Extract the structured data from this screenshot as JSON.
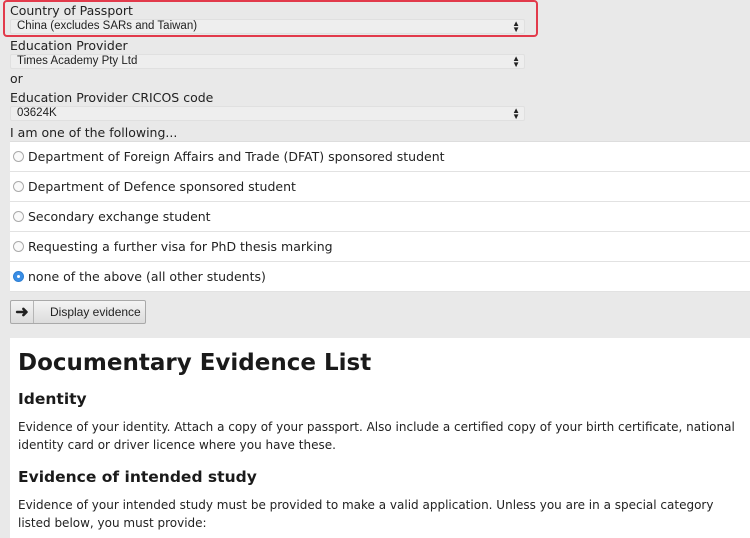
{
  "form": {
    "passport_label": "Country of Passport",
    "passport_value": "China (excludes SARs and Taiwan)",
    "provider_label": "Education Provider",
    "provider_value": "Times Academy Pty Ltd",
    "or_text": "or",
    "cricos_label": "Education Provider CRICOS code",
    "cricos_value": "03624K",
    "category_prompt": "I am one of the following...",
    "options": [
      {
        "label": "Department of Foreign Affairs and Trade (DFAT) sponsored student",
        "checked": false
      },
      {
        "label": "Department of Defence sponsored student",
        "checked": false
      },
      {
        "label": "Secondary exchange student",
        "checked": false
      },
      {
        "label": "Requesting a further visa for PhD thesis marking",
        "checked": false
      },
      {
        "label": "none of the above (all other students)",
        "checked": true
      }
    ],
    "display_button": "Display evidence"
  },
  "evidence": {
    "title": "Documentary Evidence List",
    "identity_heading": "Identity",
    "identity_text": "Evidence of your identity. Attach a copy of your passport. Also include a certified copy of your birth certificate, national identity card or driver licence where you have these.",
    "study_heading": "Evidence of intended study",
    "study_text": "Evidence of your intended study must be provided to make a valid application. Unless you are in a special category listed below, you must provide:"
  },
  "colors": {
    "highlight": "#e23a4b",
    "radio_selected": "#3a8ee6"
  }
}
